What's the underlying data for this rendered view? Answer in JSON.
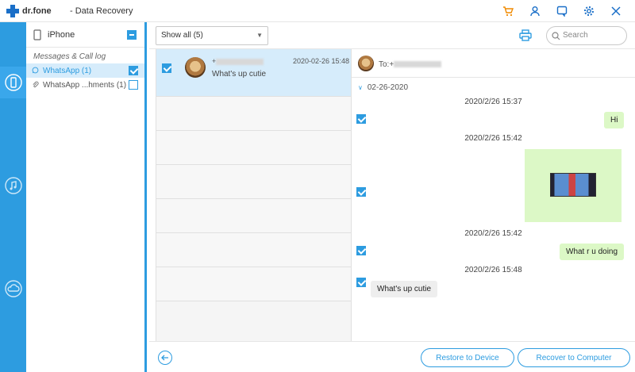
{
  "app": {
    "brand": "dr.fone",
    "title": "- Data Recovery"
  },
  "titlebar_icons": [
    "cart-icon",
    "user-icon",
    "feedback-icon",
    "settings-icon",
    "close-icon"
  ],
  "device": {
    "name": "iPhone"
  },
  "categories": {
    "group_label": "Messages & Call log",
    "items": [
      {
        "label": "WhatsApp (1)",
        "checked": true,
        "selected": true
      },
      {
        "label": "WhatsApp ...hments (1)",
        "checked": false,
        "selected": false
      }
    ]
  },
  "toolbar": {
    "filter_value": "Show all (5)",
    "search_placeholder": "Search"
  },
  "conversation": {
    "name_prefix": "+",
    "time": "2020-02-26 15:48",
    "preview": "What's up cutie"
  },
  "messages": {
    "to_prefix": "To:+",
    "date_group": "02-26-2020",
    "items": [
      {
        "time": "2020/2/26 15:37",
        "text": "Hi"
      },
      {
        "time": "2020/2/26 15:42"
      },
      {
        "time": "2020/2/26 15:42",
        "text": "What r u doing"
      },
      {
        "time": "2020/2/26 15:48",
        "text": "What's up cutie"
      }
    ]
  },
  "footer": {
    "restore_label": "Restore to Device",
    "recover_label": "Recover to Computer"
  },
  "colors": {
    "accent": "#2d9ce0",
    "bubble_out": "#dcf8c6",
    "bubble_in": "#eeeeee"
  }
}
